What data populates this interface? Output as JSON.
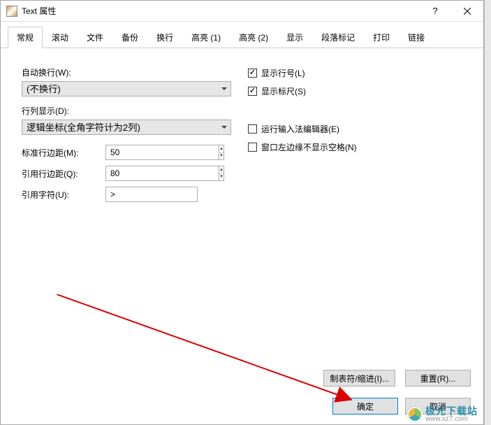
{
  "titlebar": {
    "title": "Text 属性"
  },
  "tabs": [
    "常规",
    "滚动",
    "文件",
    "备份",
    "换行",
    "高亮 (1)",
    "高亮 (2)",
    "显示",
    "段落标记",
    "打印",
    "链接"
  ],
  "active_tab": 0,
  "left": {
    "auto_wrap_label": "自动换行(W):",
    "auto_wrap_value": "(不换行)",
    "line_disp_label": "行列显示(D):",
    "line_disp_value": "逻辑坐标(全角字符计为2列)",
    "std_margin_label": "标准行边距(M):",
    "std_margin_value": "50",
    "quote_margin_label": "引用行边距(Q):",
    "quote_margin_value": "80",
    "quote_char_label": "引用字符(U):",
    "quote_char_value": ">"
  },
  "right": {
    "show_line_no": {
      "label": "显示行号(L)",
      "checked": true
    },
    "show_ruler": {
      "label": "显示标尺(S)",
      "checked": true
    },
    "ime": {
      "label": "运行输入法编辑器(E)",
      "checked": false
    },
    "no_space_left": {
      "label": "窗口左边缘不显示空格(N)",
      "checked": false
    }
  },
  "buttons": {
    "tab_indent": "制表符/缩进(I)...",
    "reset": "重置(R)...",
    "ok": "确定",
    "cancel": "取消"
  },
  "watermark": {
    "brand": "极光下载站",
    "url": "www.xz7.com"
  }
}
